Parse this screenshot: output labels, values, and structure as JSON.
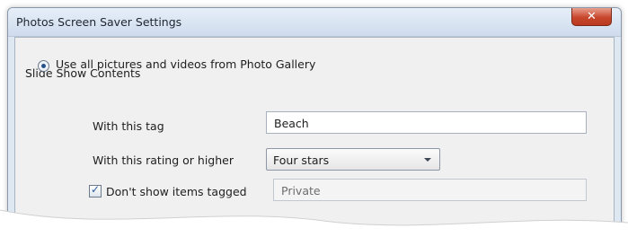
{
  "window": {
    "title": "Photos Screen Saver Settings",
    "close_icon": "close-icon"
  },
  "section": {
    "heading": "Slide Show Contents"
  },
  "source_option": {
    "label": "Use all pictures and videos from Photo Gallery",
    "selected": true
  },
  "tag_filter": {
    "label": "With this tag",
    "value": "Beach"
  },
  "rating_filter": {
    "label": "With this rating or higher",
    "selected": "Four stars"
  },
  "exclude_tagged": {
    "label": "Don't show items tagged",
    "checked": true,
    "value": "Private"
  }
}
